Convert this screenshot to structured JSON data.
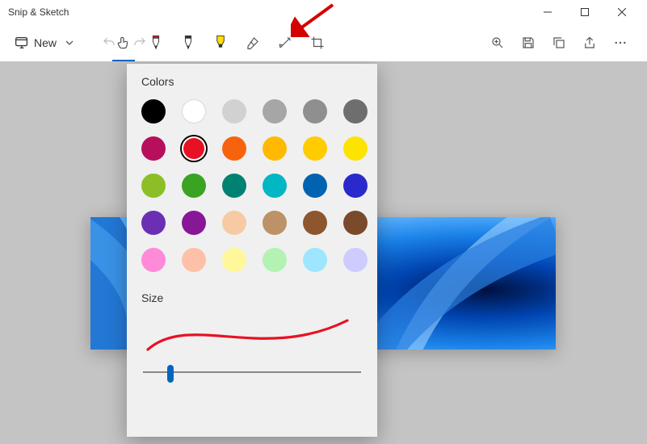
{
  "window": {
    "title": "Snip & Sketch"
  },
  "toolbar": {
    "new_label": "New"
  },
  "popup": {
    "colors_heading": "Colors",
    "size_heading": "Size",
    "colors": [
      {
        "hex": "#000000",
        "name": "black"
      },
      {
        "hex": "#ffffff",
        "name": "white",
        "white": true
      },
      {
        "hex": "#d1d1d1",
        "name": "light-gray"
      },
      {
        "hex": "#a6a6a6",
        "name": "gray"
      },
      {
        "hex": "#8f8f8f",
        "name": "dark-gray"
      },
      {
        "hex": "#6e6e6e",
        "name": "darker-gray"
      },
      {
        "hex": "#b80f5c",
        "name": "rose"
      },
      {
        "hex": "#e81123",
        "name": "red",
        "selected": true
      },
      {
        "hex": "#f7630c",
        "name": "orange"
      },
      {
        "hex": "#ffb900",
        "name": "gold"
      },
      {
        "hex": "#ffcc00",
        "name": "yellow-amber"
      },
      {
        "hex": "#fde300",
        "name": "yellow"
      },
      {
        "hex": "#8cbf26",
        "name": "lime"
      },
      {
        "hex": "#3aa322",
        "name": "green"
      },
      {
        "hex": "#008272",
        "name": "teal"
      },
      {
        "hex": "#00b7c3",
        "name": "cyan"
      },
      {
        "hex": "#0063b1",
        "name": "blue"
      },
      {
        "hex": "#2929cc",
        "name": "indigo"
      },
      {
        "hex": "#6b2fb3",
        "name": "purple"
      },
      {
        "hex": "#881798",
        "name": "violet"
      },
      {
        "hex": "#f6cba4",
        "name": "peach"
      },
      {
        "hex": "#bc9267",
        "name": "tan"
      },
      {
        "hex": "#8e562e",
        "name": "brown"
      },
      {
        "hex": "#7a4b2a",
        "name": "dark-brown"
      },
      {
        "hex": "#ff8ad8",
        "name": "pink"
      },
      {
        "hex": "#ffc0a8",
        "name": "light-orange"
      },
      {
        "hex": "#fff799",
        "name": "light-yellow"
      },
      {
        "hex": "#b3f2b3",
        "name": "light-green"
      },
      {
        "hex": "#9ee6ff",
        "name": "light-blue"
      },
      {
        "hex": "#ccccff",
        "name": "lavender"
      }
    ],
    "size_value": 12,
    "size_min": 1,
    "size_max": 100,
    "stroke_color": "#e81123"
  },
  "colors": {
    "accent": "#0067c0"
  }
}
